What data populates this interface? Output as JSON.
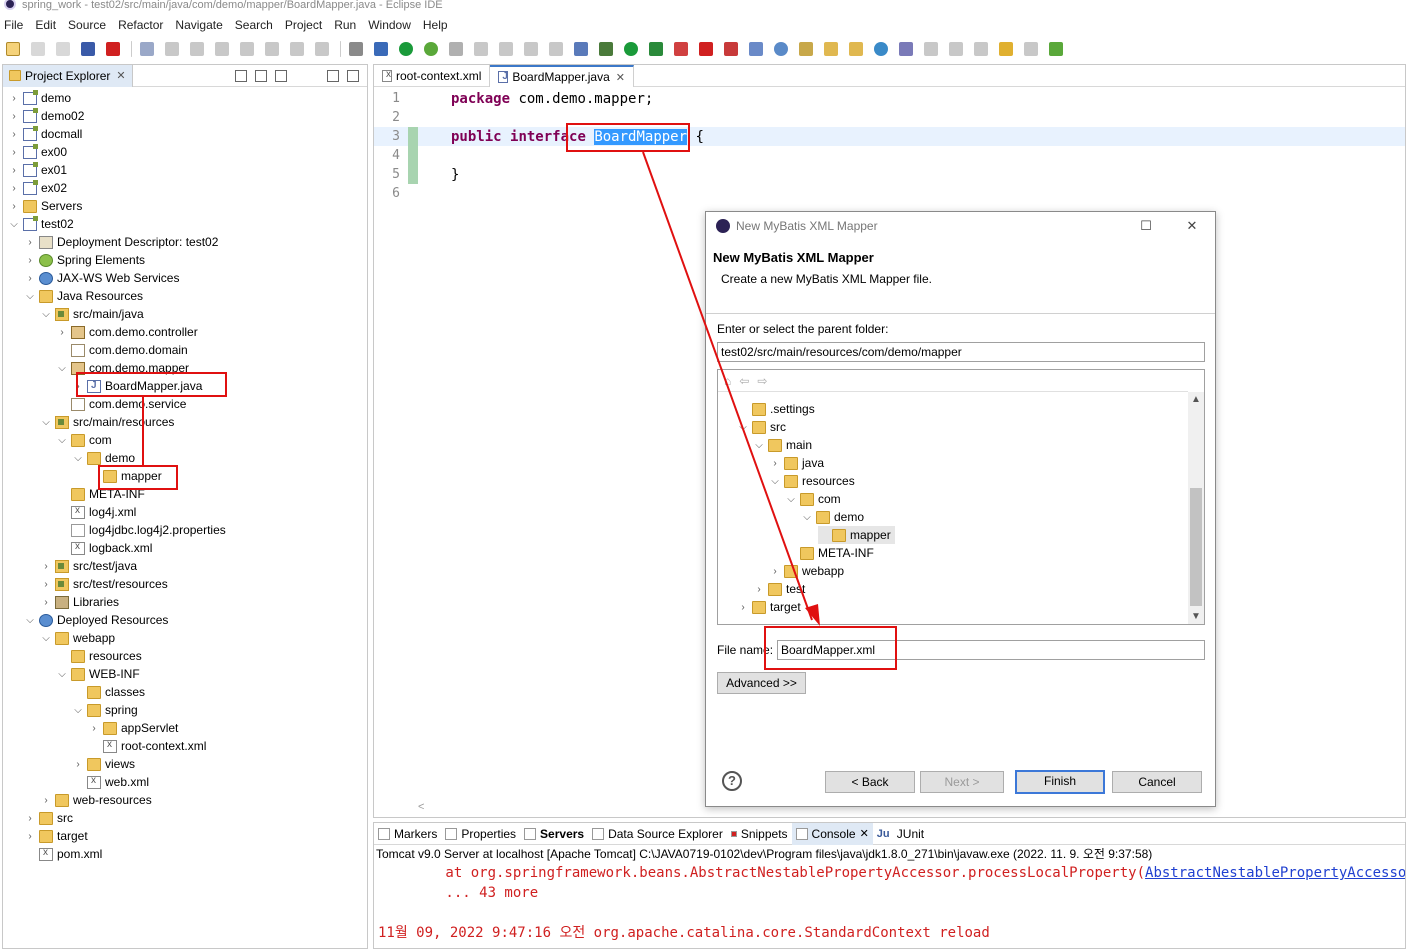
{
  "window": {
    "title": "spring_work - test02/src/main/java/com/demo/mapper/BoardMapper.java - Eclipse IDE"
  },
  "menubar": [
    "File",
    "Edit",
    "Source",
    "Refactor",
    "Navigate",
    "Search",
    "Project",
    "Run",
    "Window",
    "Help"
  ],
  "project_explorer": {
    "tab_label": "Project Explorer",
    "items": [
      {
        "label": "demo",
        "icon": "project-icon",
        "depth": 0,
        "expanded": false
      },
      {
        "label": "demo02",
        "icon": "project-icon",
        "depth": 0,
        "expanded": false
      },
      {
        "label": "docmall",
        "icon": "project-icon",
        "depth": 0,
        "expanded": false
      },
      {
        "label": "ex00",
        "icon": "project-icon",
        "depth": 0,
        "expanded": false
      },
      {
        "label": "ex01",
        "icon": "project-icon",
        "depth": 0,
        "expanded": false
      },
      {
        "label": "ex02",
        "icon": "project-icon",
        "depth": 0,
        "expanded": false
      },
      {
        "label": "Servers",
        "icon": "folder-icon",
        "depth": 0,
        "expanded": false
      },
      {
        "label": "test02",
        "icon": "project-icon",
        "depth": 0,
        "expanded": true
      },
      {
        "label": "Deployment Descriptor: test02",
        "icon": "descriptor-icon",
        "depth": 1,
        "expanded": false
      },
      {
        "label": "Spring Elements",
        "icon": "spring-icon",
        "depth": 1,
        "expanded": false
      },
      {
        "label": "JAX-WS Web Services",
        "icon": "webservice-icon",
        "depth": 1,
        "expanded": false
      },
      {
        "label": "Java Resources",
        "icon": "java-resources-icon",
        "depth": 1,
        "expanded": true
      },
      {
        "label": "src/main/java",
        "icon": "source-folder-icon",
        "depth": 2,
        "expanded": true
      },
      {
        "label": "com.demo.controller",
        "icon": "package-icon",
        "depth": 3,
        "expanded": false
      },
      {
        "label": "com.demo.domain",
        "icon": "empty-package-icon",
        "depth": 3,
        "expanded": null
      },
      {
        "label": "com.demo.mapper",
        "icon": "package-icon",
        "depth": 3,
        "expanded": true
      },
      {
        "label": "BoardMapper.java",
        "icon": "java-file-icon",
        "depth": 4,
        "expanded": false
      },
      {
        "label": "com.demo.service",
        "icon": "empty-package-icon",
        "depth": 3,
        "expanded": null
      },
      {
        "label": "src/main/resources",
        "icon": "source-folder-icon",
        "depth": 2,
        "expanded": true
      },
      {
        "label": "com",
        "icon": "folder-icon",
        "depth": 3,
        "expanded": true
      },
      {
        "label": "demo",
        "icon": "folder-icon",
        "depth": 4,
        "expanded": true
      },
      {
        "label": "mapper",
        "icon": "folder-icon",
        "depth": 5,
        "expanded": null
      },
      {
        "label": "META-INF",
        "icon": "folder-icon",
        "depth": 3,
        "expanded": null
      },
      {
        "label": "log4j.xml",
        "icon": "xml-file-icon",
        "depth": 3,
        "expanded": null
      },
      {
        "label": "log4jdbc.log4j2.properties",
        "icon": "file-icon",
        "depth": 3,
        "expanded": null
      },
      {
        "label": "logback.xml",
        "icon": "xml-file-icon",
        "depth": 3,
        "expanded": null
      },
      {
        "label": "src/test/java",
        "icon": "source-folder-icon",
        "depth": 2,
        "expanded": false
      },
      {
        "label": "src/test/resources",
        "icon": "source-folder-icon",
        "depth": 2,
        "expanded": false
      },
      {
        "label": "Libraries",
        "icon": "library-icon",
        "depth": 2,
        "expanded": false
      },
      {
        "label": "Deployed Resources",
        "icon": "deployed-resources-icon",
        "depth": 1,
        "expanded": true
      },
      {
        "label": "webapp",
        "icon": "folder-icon",
        "depth": 2,
        "expanded": true
      },
      {
        "label": "resources",
        "icon": "folder-icon",
        "depth": 3,
        "expanded": null
      },
      {
        "label": "WEB-INF",
        "icon": "folder-icon",
        "depth": 3,
        "expanded": true
      },
      {
        "label": "classes",
        "icon": "folder-icon",
        "depth": 4,
        "expanded": null
      },
      {
        "label": "spring",
        "icon": "folder-icon",
        "depth": 4,
        "expanded": true
      },
      {
        "label": "appServlet",
        "icon": "folder-icon",
        "depth": 5,
        "expanded": false
      },
      {
        "label": "root-context.xml",
        "icon": "xml-file-icon",
        "depth": 5,
        "expanded": null
      },
      {
        "label": "views",
        "icon": "folder-icon",
        "depth": 4,
        "expanded": false
      },
      {
        "label": "web.xml",
        "icon": "xml-file-icon",
        "depth": 4,
        "expanded": null
      },
      {
        "label": "web-resources",
        "icon": "folder-icon",
        "depth": 2,
        "expanded": false
      },
      {
        "label": "src",
        "icon": "folder-icon",
        "depth": 1,
        "expanded": false
      },
      {
        "label": "target",
        "icon": "folder-icon",
        "depth": 1,
        "expanded": false
      },
      {
        "label": "pom.xml",
        "icon": "maven-file-icon",
        "depth": 1,
        "expanded": null
      }
    ]
  },
  "editor": {
    "tabs": [
      {
        "label": "root-context.xml",
        "active": false
      },
      {
        "label": "BoardMapper.java",
        "active": true
      }
    ],
    "lines": [
      {
        "num": "1",
        "parts": [
          {
            "t": "package",
            "kw": true
          },
          {
            "t": " com.demo.mapper;"
          }
        ]
      },
      {
        "num": "2",
        "parts": []
      },
      {
        "num": "3",
        "parts": [
          {
            "t": "public",
            "kw": true
          },
          {
            "t": " "
          },
          {
            "t": "interface",
            "kw": true
          },
          {
            "t": " "
          },
          {
            "t": "BoardMapper",
            "sel": true
          },
          {
            "t": " {"
          }
        ]
      },
      {
        "num": "4",
        "parts": []
      },
      {
        "num": "5",
        "parts": [
          {
            "t": "}"
          }
        ]
      },
      {
        "num": "6",
        "parts": []
      }
    ]
  },
  "bottom_panel": {
    "tabs": [
      {
        "label": "Markers",
        "icon": "markers-icon"
      },
      {
        "label": "Properties",
        "icon": "properties-icon"
      },
      {
        "label": "Servers",
        "icon": "servers-icon",
        "bold": true
      },
      {
        "label": "Data Source Explorer",
        "icon": "data-source-icon"
      },
      {
        "label": "Snippets",
        "icon": "snippets-icon"
      },
      {
        "label": "Console",
        "icon": "console-icon",
        "active": true
      },
      {
        "label": "JUnit",
        "icon": "junit-icon"
      }
    ],
    "console_header": "Tomcat v9.0 Server at localhost [Apache Tomcat] C:\\JAVA0719-0102\\dev\\Program files\\java\\jdk1.8.0_271\\bin\\javaw.exe  (2022. 11. 9. 오전 9:37:58)",
    "console_lines": [
      {
        "text": "        at org.springframework.beans.AbstractNestablePropertyAccessor.processLocalProperty(",
        "link": "AbstractNestablePropertyAccessor"
      },
      {
        "text": "        ... 43 more",
        "link": ""
      },
      {
        "text": "",
        "link": ""
      },
      {
        "text": "11월 09, 2022 9:47:16 오전 org.apache.catalina.core.StandardContext reload",
        "link": ""
      }
    ]
  },
  "dialog": {
    "window_title": "New MyBatis XML Mapper",
    "heading": "New MyBatis XML Mapper",
    "description": "Create a new MyBatis XML Mapper file.",
    "parent_folder_label": "Enter or select the parent folder:",
    "parent_folder_value": "test02/src/main/resources/com/demo/mapper",
    "tree": [
      {
        "label": ".settings",
        "depth": 0,
        "arrow": ""
      },
      {
        "label": "src",
        "depth": 0,
        "arrow": "v"
      },
      {
        "label": "main",
        "depth": 1,
        "arrow": "v"
      },
      {
        "label": "java",
        "depth": 2,
        "arrow": ">"
      },
      {
        "label": "resources",
        "depth": 2,
        "arrow": "v"
      },
      {
        "label": "com",
        "depth": 3,
        "arrow": "v"
      },
      {
        "label": "demo",
        "depth": 4,
        "arrow": "v"
      },
      {
        "label": "mapper",
        "depth": 5,
        "arrow": "",
        "selected": true
      },
      {
        "label": "META-INF",
        "depth": 3,
        "arrow": ""
      },
      {
        "label": "webapp",
        "depth": 2,
        "arrow": ">"
      },
      {
        "label": "test",
        "depth": 1,
        "arrow": ">"
      },
      {
        "label": "target",
        "depth": 0,
        "arrow": ">"
      }
    ],
    "file_name_label": "File name:",
    "file_name_value": "BoardMapper.xml",
    "advanced_label": "Advanced >>",
    "back_label": "< Back",
    "next_label": "Next >",
    "finish_label": "Finish",
    "cancel_label": "Cancel"
  },
  "colors": {
    "annotation_red": "#e01010",
    "keyword": "#7f0055",
    "selection": "#3399ff",
    "console_error": "#d02020"
  }
}
